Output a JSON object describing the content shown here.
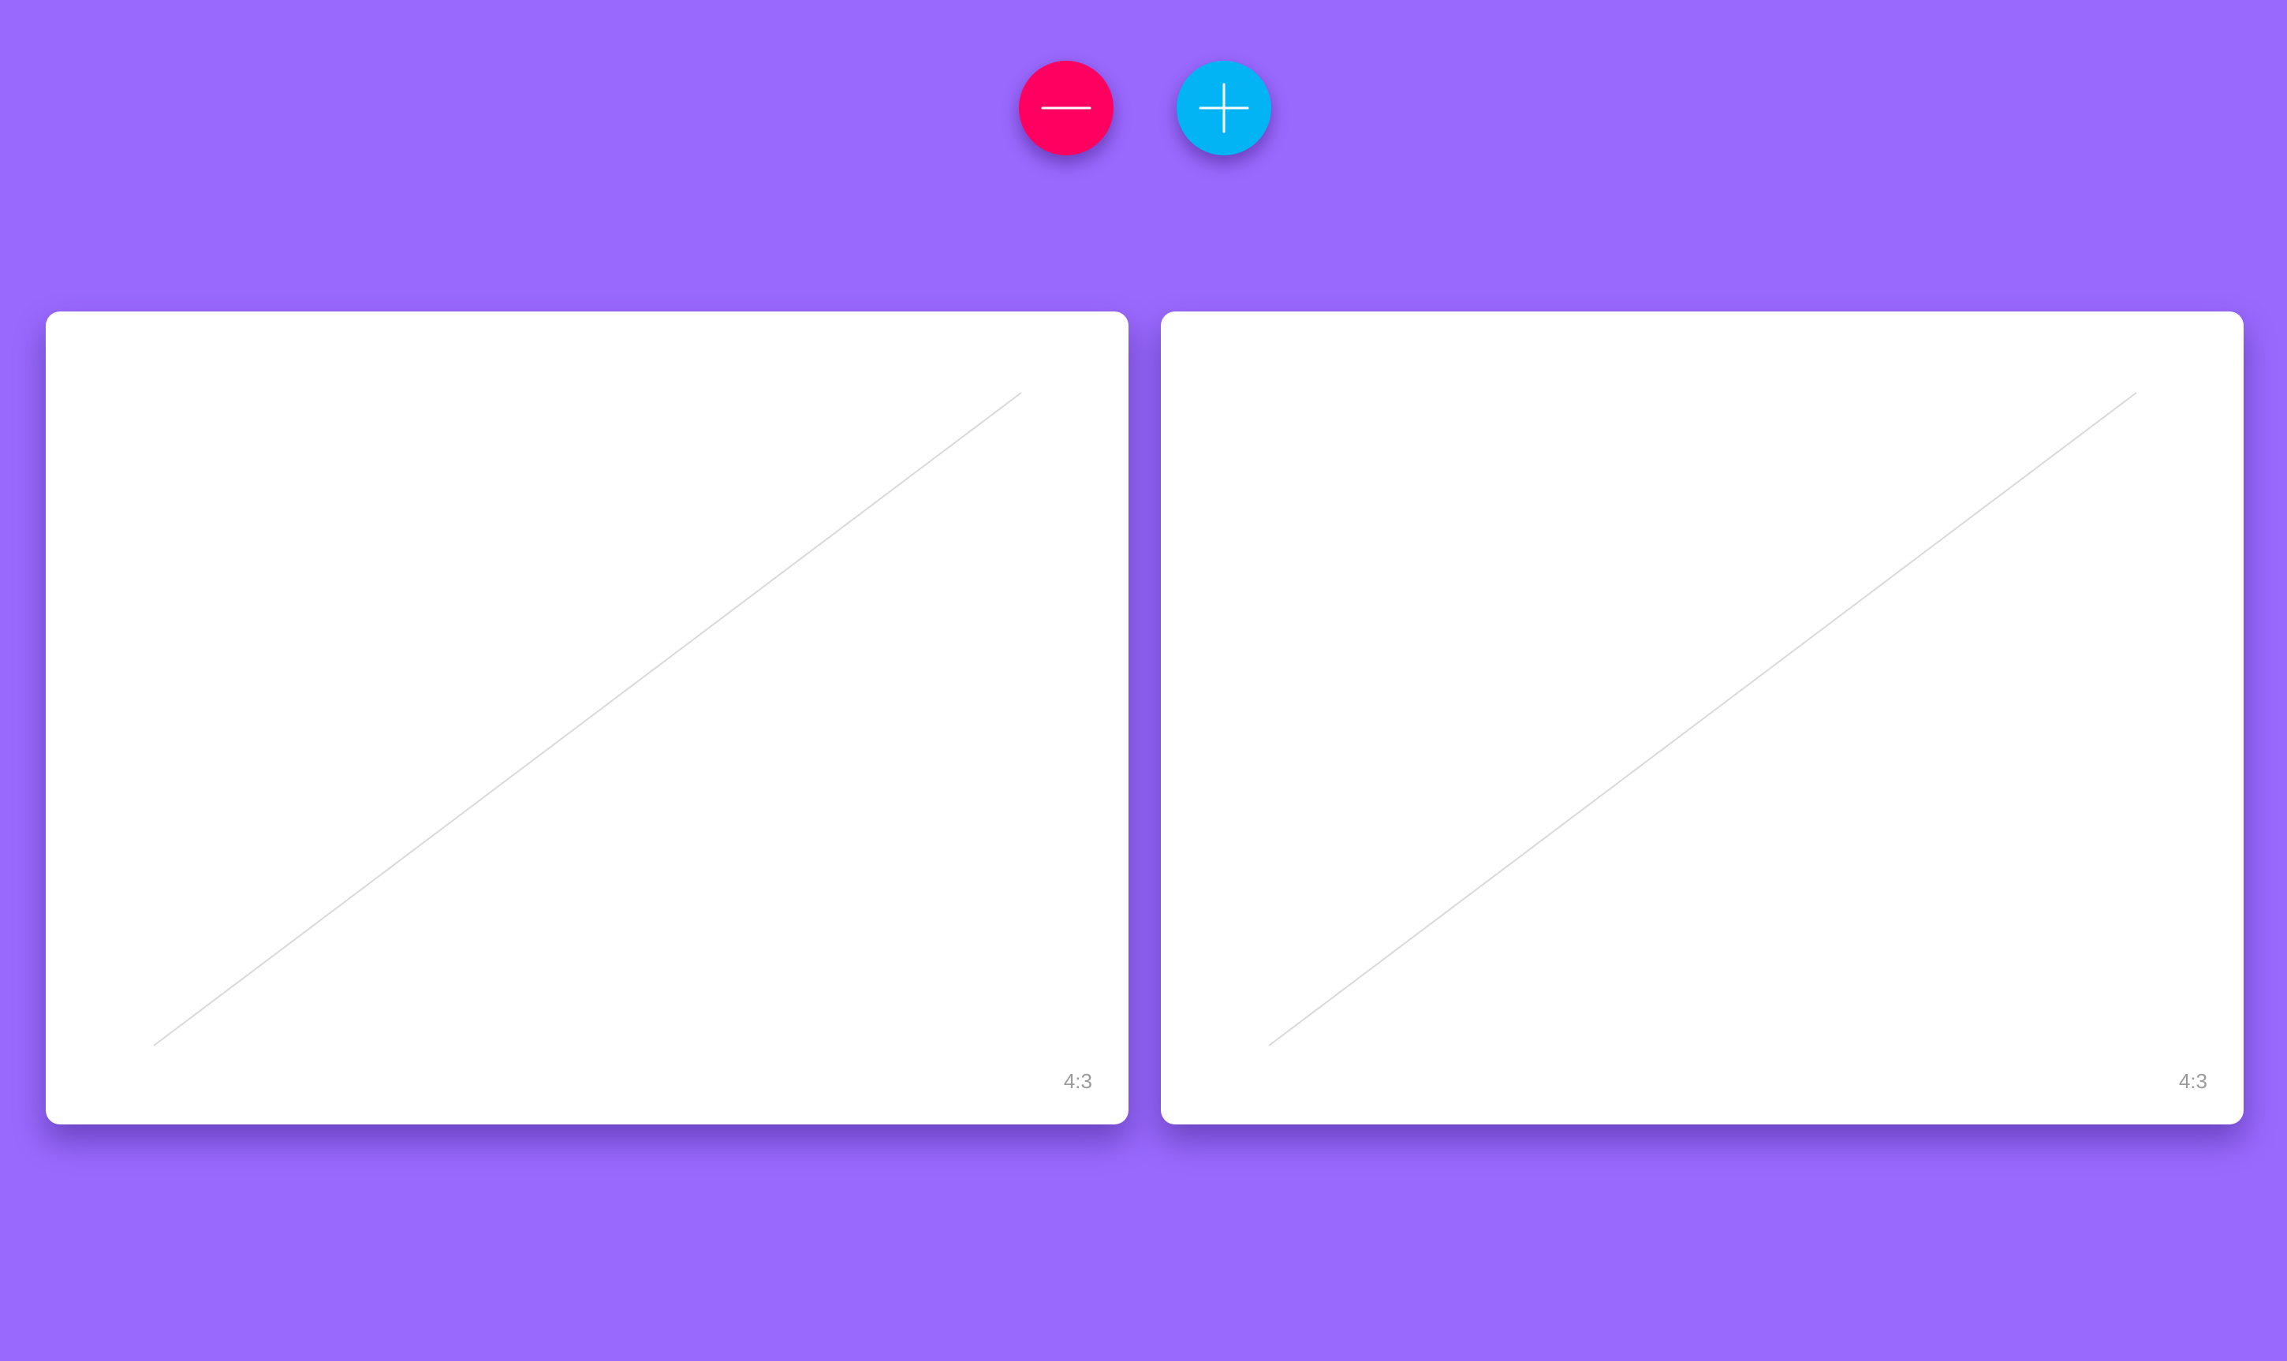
{
  "colors": {
    "background": "#9969FD",
    "minus_button": "#FF0060",
    "plus_button": "#03B4F5",
    "card": "#FFFFFF",
    "placeholder_line": "#D9D9D9",
    "ratio_text": "#9A9A9A"
  },
  "controls": {
    "minus_icon": "minus-icon",
    "plus_icon": "plus-icon"
  },
  "cards": [
    {
      "ratio_label": "4:3"
    },
    {
      "ratio_label": "4:3"
    }
  ]
}
